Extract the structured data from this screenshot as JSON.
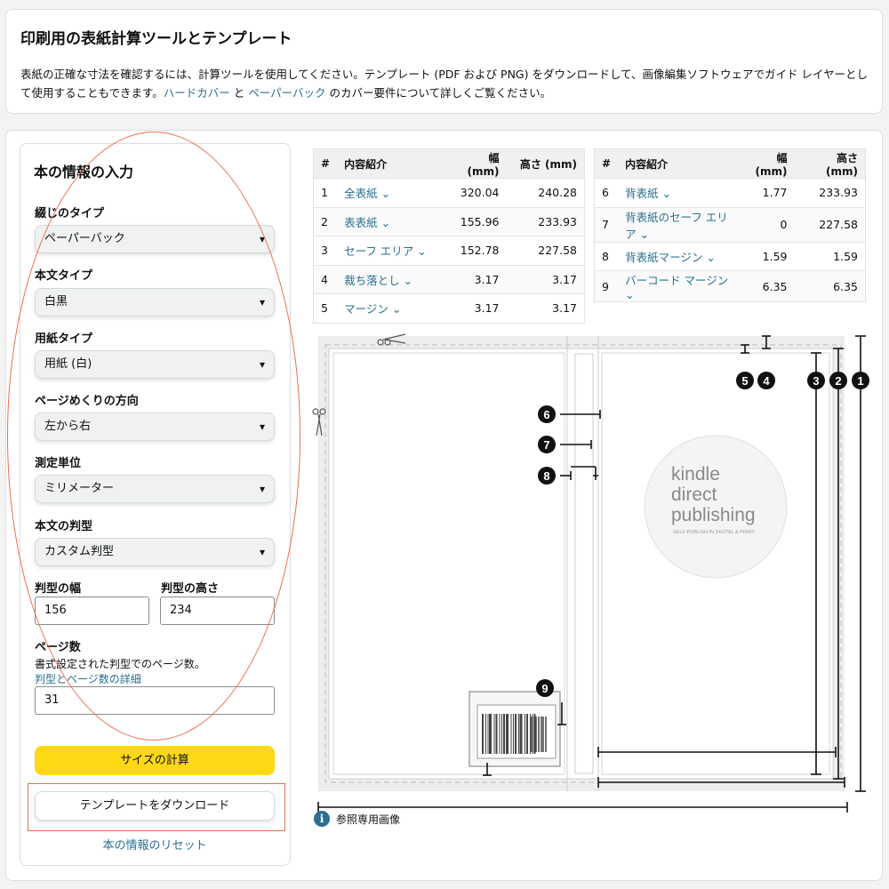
{
  "header": {
    "title": "印刷用の表紙計算ツールとテンプレート",
    "desc_1": "表紙の正確な寸法を確認するには、計算ツールを使用してください。テンプレート (PDF および PNG) をダウンロードして、画像編集ソフトウェアでガイド レイヤーとして使用することもできます。",
    "link_hardcover": "ハードカバー",
    "and": " と ",
    "link_paperback": "ペーパーバック",
    "desc_2": " のカバー要件について詳しくご覧ください。"
  },
  "form": {
    "title": "本の情報の入力",
    "binding": {
      "label": "綴じのタイプ",
      "value": "ペーパーバック"
    },
    "interior": {
      "label": "本文タイプ",
      "value": "白黒"
    },
    "paper": {
      "label": "用紙タイプ",
      "value": "用紙 (白)"
    },
    "direction": {
      "label": "ページめくりの方向",
      "value": "左から右"
    },
    "unit": {
      "label": "測定単位",
      "value": "ミリメーター"
    },
    "trim": {
      "label": "本文の判型",
      "value": "カスタム判型"
    },
    "trim_width": {
      "label": "判型の幅",
      "value": "156"
    },
    "trim_height": {
      "label": "判型の高さ",
      "value": "234"
    },
    "pages": {
      "label": "ページ数",
      "help": "書式設定された判型でのページ数。",
      "link": "判型とページ数の詳細",
      "value": "31"
    },
    "calc_button": "サイズの計算",
    "download_button": "テンプレートをダウンロード",
    "reset_link": "本の情報のリセット"
  },
  "table_headers": {
    "num": "#",
    "name": "内容紹介",
    "width": "幅 (mm)",
    "height": "高さ (mm)"
  },
  "table_left": [
    {
      "n": "1",
      "name": "全表紙",
      "w": "320.04",
      "h": "240.28"
    },
    {
      "n": "2",
      "name": "表表紙",
      "w": "155.96",
      "h": "233.93"
    },
    {
      "n": "3",
      "name": "セーフ エリア",
      "w": "152.78",
      "h": "227.58"
    },
    {
      "n": "4",
      "name": "裁ち落とし",
      "w": "3.17",
      "h": "3.17"
    },
    {
      "n": "5",
      "name": "マージン",
      "w": "3.17",
      "h": "3.17"
    }
  ],
  "table_right": [
    {
      "n": "6",
      "name": "背表紙",
      "w": "1.77",
      "h": "233.93"
    },
    {
      "n": "7",
      "name": "背表紙のセーフ エリア",
      "w": "0",
      "h": "227.58"
    },
    {
      "n": "8",
      "name": "背表紙マージン",
      "w": "1.59",
      "h": "1.59"
    },
    {
      "n": "9",
      "name": "バーコード マージン",
      "w": "6.35",
      "h": "6.35"
    }
  ],
  "diagram": {
    "logo_line1": "kindle",
    "logo_line2": "direct",
    "logo_line3": "publishing",
    "logo_tagline": "SELF-PUBLISH IN DIGITAL & PRINT",
    "markers": [
      "1",
      "2",
      "3",
      "4",
      "5",
      "6",
      "7",
      "8",
      "9"
    ]
  },
  "reference_note": "参照専用画像",
  "info_icon_glyph": "i",
  "chevron_glyph": "⌄",
  "colors": {
    "accent": "#2a6f8f",
    "button": "#ffd814",
    "annotation": "#e8704a"
  }
}
